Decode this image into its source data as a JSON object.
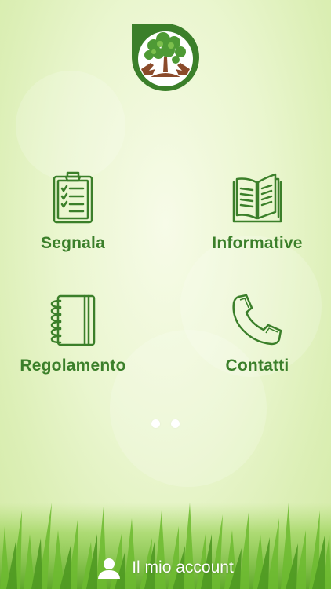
{
  "colors": {
    "brand_green": "#3b7f2a",
    "icon_green": "#3b7f2a",
    "logo_brown": "#8b4a2b",
    "background": "#e6f4c9"
  },
  "logo": {
    "icon": "tree-hands-logo"
  },
  "menu": {
    "items": [
      {
        "label": "Segnala",
        "icon": "clipboard-checklist-icon"
      },
      {
        "label": "Informative",
        "icon": "open-book-icon"
      },
      {
        "label": "Regolamento",
        "icon": "notebook-icon"
      },
      {
        "label": "Contatti",
        "icon": "phone-handset-icon"
      }
    ]
  },
  "pagination": {
    "pages": 2,
    "current": 1
  },
  "footer": {
    "account_label": "Il mio account",
    "icon": "user-icon"
  }
}
